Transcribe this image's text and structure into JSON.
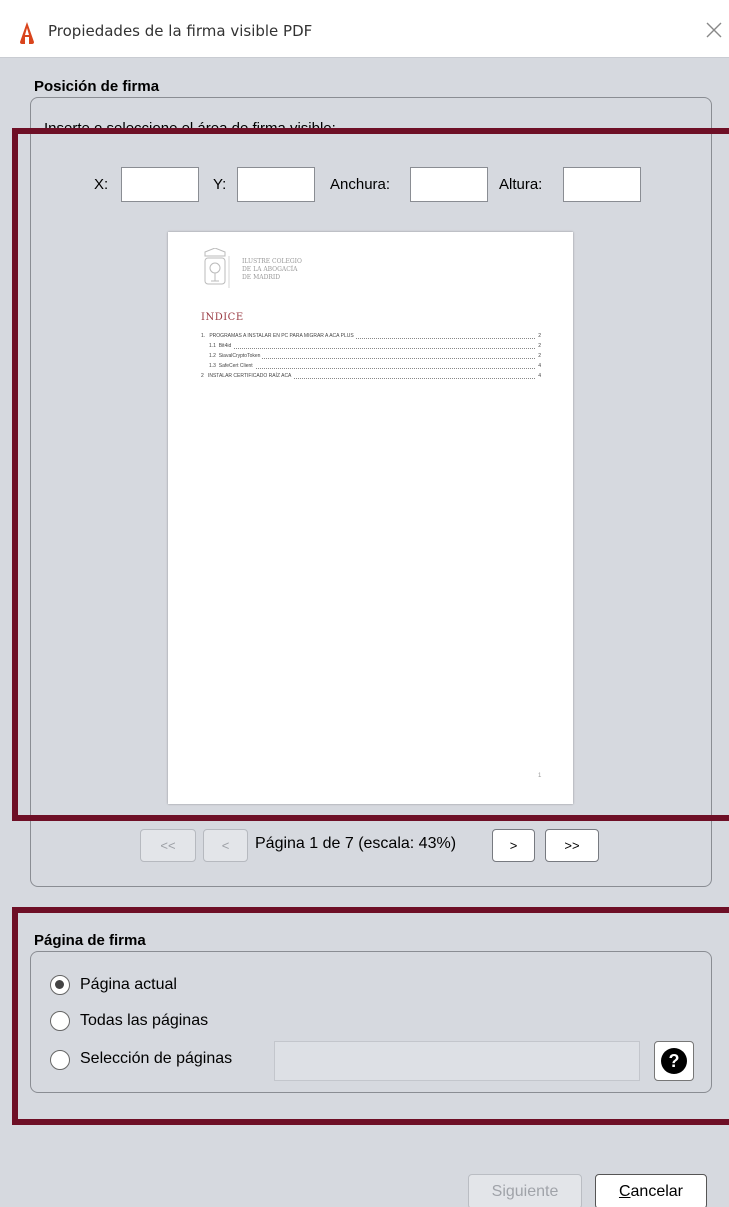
{
  "window": {
    "title": "Propiedades de la firma visible PDF"
  },
  "position_section": {
    "title": "Posición de firma",
    "instruction": "Inserte o seleccione el área de firma visible:",
    "fields": {
      "x_label": "X:",
      "y_label": "Y:",
      "width_label": "Anchura:",
      "height_label": "Altura:",
      "x_value": "",
      "y_value": "",
      "width_value": "",
      "height_value": ""
    }
  },
  "preview": {
    "org_line1": "ILUSTRE COLEGIO",
    "org_line2": "DE LA ABOGACÍA",
    "org_line3": "DE MADRID",
    "index_title": "INDICE",
    "toc": [
      {
        "num": "1.",
        "text": "PROGRAMAS A INSTALAR EN PC PARA MIGRAR A ACA PLUS",
        "page": "2"
      },
      {
        "num": "1.1",
        "text": "Bit4id",
        "page": "2"
      },
      {
        "num": "1.2",
        "text": "SiavalCryptoToken",
        "page": "2"
      },
      {
        "num": "1.3",
        "text": "SafeCert Client",
        "page": "4"
      },
      {
        "num": "2",
        "text": "INSTALAR CERTIFICADO RAÍZ ACA",
        "page": "4"
      }
    ],
    "page_number": "1"
  },
  "navigation": {
    "first_label": "<<",
    "prev_label": "<",
    "next_label": ">",
    "last_label": ">>",
    "page_info": "Página 1 de 7 (escala: 43%)"
  },
  "page_section": {
    "title": "Página de firma",
    "options": [
      {
        "label": "Página actual",
        "checked": true
      },
      {
        "label": "Todas las páginas",
        "checked": false
      },
      {
        "label": "Selección de páginas",
        "checked": false
      }
    ],
    "selection_value": "",
    "help_icon": "question-icon"
  },
  "footer": {
    "next_label": "Siguiente",
    "cancel_prefix": "C",
    "cancel_rest": "ancelar"
  },
  "colors": {
    "highlight": "#6e0f26",
    "app_icon": "#d9441c",
    "index_title": "#9b3c45"
  }
}
